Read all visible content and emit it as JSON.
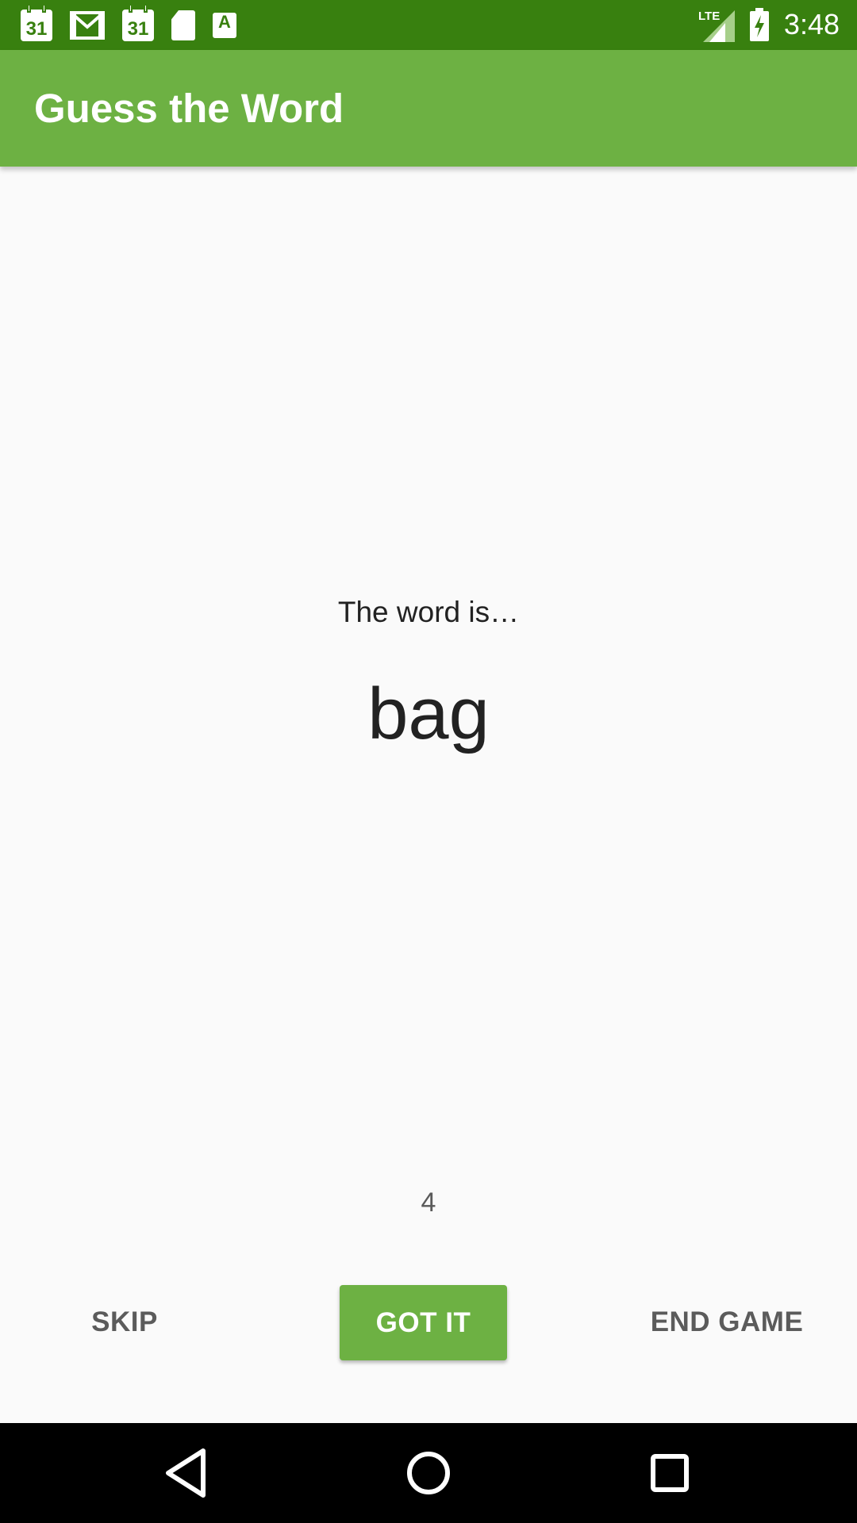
{
  "status_bar": {
    "time": "3:48",
    "calendar_day_1": "31",
    "calendar_day_2": "31",
    "font_icon_letter": "A",
    "network_label": "LTE",
    "icons": [
      "calendar-icon",
      "gmail-icon",
      "calendar-icon",
      "sd-card-icon",
      "font-download-icon",
      "lte-signal-icon",
      "battery-charging-icon"
    ]
  },
  "app_bar": {
    "title": "Guess the Word"
  },
  "game": {
    "word_label": "The word is…",
    "word": "bag",
    "timer": "4"
  },
  "buttons": {
    "skip": "SKIP",
    "got_it": "GOT IT",
    "end_game": "END GAME"
  },
  "nav_bar": {
    "icons": [
      "back-icon",
      "home-icon",
      "recent-apps-icon"
    ]
  },
  "colors": {
    "status_bar": "#38800f",
    "app_bar": "#6db143",
    "accent": "#6db143",
    "background": "#fafafa",
    "text_primary": "#222222",
    "text_secondary": "#5b5b5b"
  }
}
